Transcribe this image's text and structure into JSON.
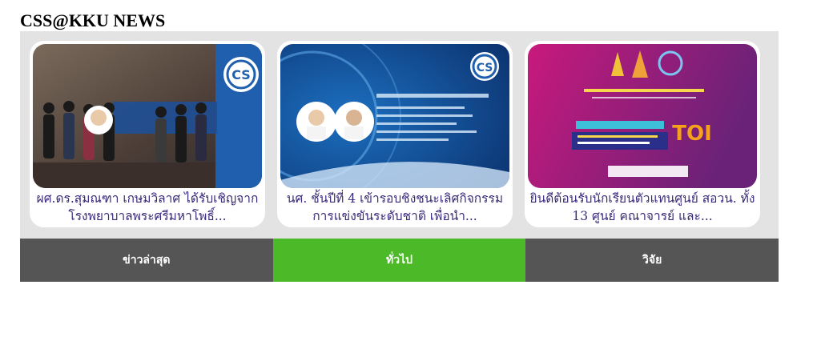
{
  "page": {
    "title": "CSS@KKU NEWS"
  },
  "news": [
    {
      "caption": "ผศ.ดร.สุมณฑา เกษมวิลาศ ได้รับเชิญจากโรงพยาบาลพระศรีมหาโพธิ์...",
      "logo_text": "CS"
    },
    {
      "caption": "นศ. ชั้นปีที่ 4 เข้ารอบชิงชนะเลิศกิจกรรมการแข่งขันระดับชาติ เพื่อนำ...",
      "logo_text": "CS"
    },
    {
      "caption": "ยินดีต้อนรับนักเรียนตัวแทนศูนย์ สอวน. ทั้ง 13 ศูนย์ คณาจารย์ และ...",
      "logo_text": "TOI"
    }
  ],
  "tabs": [
    {
      "label": "ข่าวล่าสุด",
      "active": false
    },
    {
      "label": "ทั่วไป",
      "active": true
    },
    {
      "label": "วิจัย",
      "active": false
    }
  ],
  "colors": {
    "tab_active": "#4cba28",
    "tab_inactive": "#555555",
    "panel_bg": "#e3e3e3",
    "caption_text": "#3b2a7a"
  }
}
